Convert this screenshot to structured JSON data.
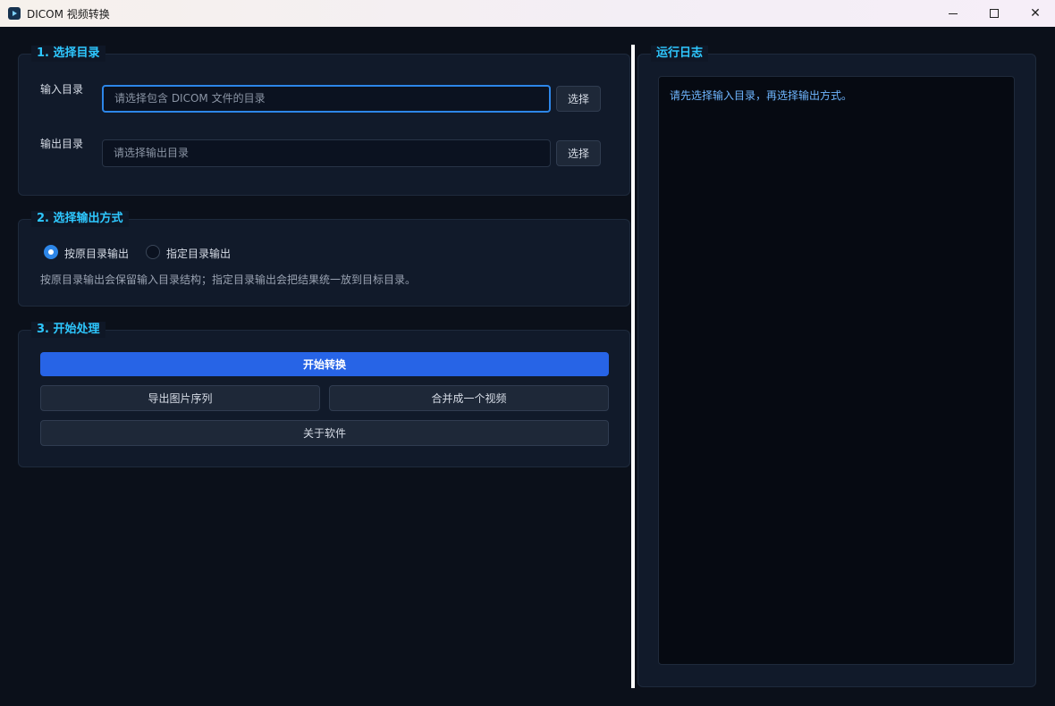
{
  "window": {
    "title": "DICOM 视频转换",
    "icon": "app-icon"
  },
  "section1": {
    "title": "1. 选择目录",
    "input_dir": {
      "label": "输入目录",
      "placeholder": "请选择包含 DICOM 文件的目录",
      "value": "",
      "button": "选择"
    },
    "output_dir": {
      "label": "输出目录",
      "placeholder": "请选择输出目录",
      "value": "",
      "button": "选择"
    }
  },
  "section2": {
    "title": "2. 选择输出方式",
    "options": [
      {
        "label": "按原目录输出",
        "selected": true
      },
      {
        "label": "指定目录输出",
        "selected": false
      }
    ],
    "hint": "按原目录输出会保留输入目录结构；指定目录输出会把结果统一放到目标目录。"
  },
  "section3": {
    "title": "3. 开始处理",
    "start_button": "开始转换",
    "export_button": "导出图片序列",
    "merge_button": "合并成一个视频",
    "about_button": "关于软件"
  },
  "log": {
    "title": "运行日志",
    "lines": [
      "请先选择输入目录，再选择输出方式。"
    ]
  },
  "colors": {
    "accent": "#2ec8ff",
    "primary": "#2764e6",
    "log_text": "#6fb6ff",
    "background": "#0b101a"
  }
}
